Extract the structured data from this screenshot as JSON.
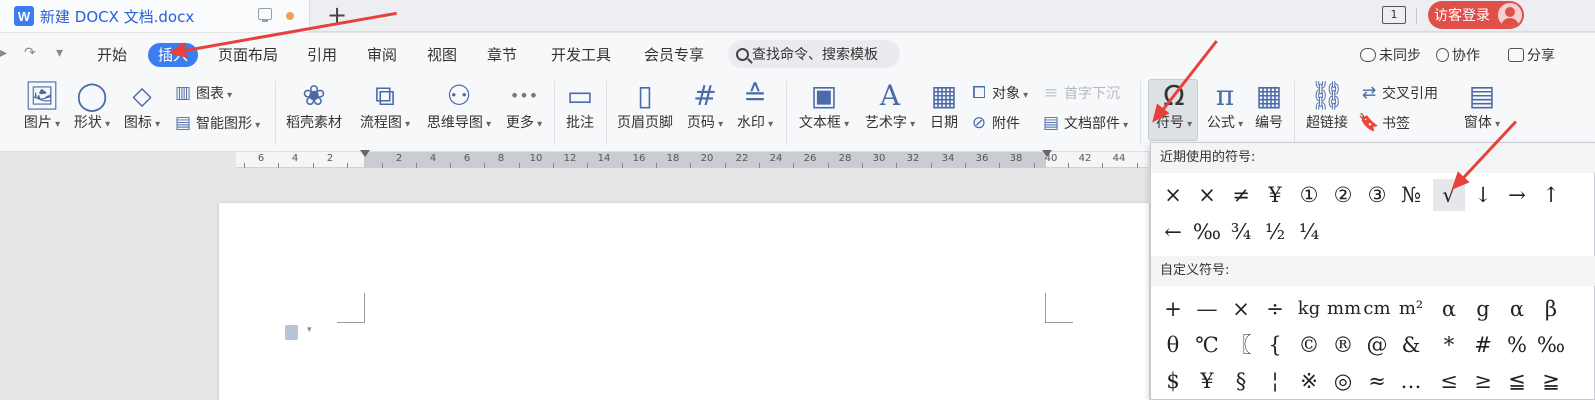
{
  "title_bar": {
    "doc_title": "新建 DOCX 文档.docx",
    "new_tab_glyph": "+",
    "window_badge": "1",
    "login_label": "访客登录"
  },
  "quick_access": {
    "undo": "↶",
    "redo": "↷",
    "more": "▾"
  },
  "menu": {
    "tabs": [
      "开始",
      "插入",
      "页面布局",
      "引用",
      "审阅",
      "视图",
      "章节",
      "开发工具",
      "会员专享"
    ],
    "active_tab": "插入",
    "search_placeholder": "查找命令、搜索模板",
    "right": {
      "sync": "未同步",
      "collab": "协作",
      "share": "分享"
    }
  },
  "ribbon": {
    "picture": "图片",
    "shape": "形状",
    "icon": "图标",
    "chart": "图表",
    "smart_graphic": "智能图形",
    "stock_material": "稻壳素材",
    "flowchart": "流程图",
    "mindmap": "思维导图",
    "more": "更多",
    "comment": "批注",
    "header_footer": "页眉页脚",
    "page_number": "页码",
    "watermark": "水印",
    "textbox": "文本框",
    "wordart": "艺术字",
    "date": "日期",
    "object": "对象",
    "attachment": "附件",
    "drop_cap": "首字下沉",
    "doc_parts": "文档部件",
    "symbol": "符号",
    "formula": "公式",
    "numbering": "编号",
    "hyperlink": "超链接",
    "cross_ref": "交叉引用",
    "bookmark": "书签",
    "window": "窗体"
  },
  "ruler": {
    "labels": [
      "6",
      "4",
      "2",
      "2",
      "4",
      "6",
      "8",
      "10",
      "12",
      "14",
      "16",
      "18",
      "20",
      "22",
      "24",
      "26",
      "28",
      "30",
      "32",
      "34",
      "36",
      "38",
      "40",
      "42",
      "44"
    ]
  },
  "symbol_panel": {
    "recent_title": "近期使用的符号:",
    "recent": [
      "×",
      "×",
      "≠",
      "¥",
      "①",
      "②",
      "③",
      "№",
      "√",
      "↓",
      "→",
      "↑",
      "←",
      "‰",
      "¾",
      "½",
      "¼"
    ],
    "highlighted": "√",
    "custom_title": "自定义符号:",
    "custom": [
      "+",
      "—",
      "×",
      "÷",
      "kg",
      "mm",
      "cm",
      "m²",
      "α",
      "g",
      "α",
      "β",
      "θ",
      "℃",
      "〖",
      "{",
      "©",
      "®",
      "@",
      "&",
      "*",
      "#",
      "%",
      "‰",
      "$",
      "¥",
      "§",
      "¦",
      "※",
      "◎",
      "≈",
      "…",
      "≤",
      "≥",
      "≦",
      "≧"
    ]
  },
  "icons": {
    "picture": "🖼",
    "shape": "◯",
    "icon": "⬦",
    "chart": "▥",
    "smart": "▤",
    "stock": "❀",
    "flow": "⧉",
    "mind": "⚇",
    "more": "•••",
    "comment": "▭",
    "header": "▯",
    "pagenum": "#",
    "watermark": "≙",
    "textbox": "▣",
    "wordart": "A",
    "date": "▦",
    "object": "⧠",
    "attach": "⊘",
    "dropcap": "≡",
    "docparts": "▤",
    "symbol": "Ω",
    "formula": "π",
    "numbering": "▦",
    "hyperlink": "⛓",
    "crossref": "⇄",
    "bookmark": "🔖",
    "window": "▤"
  }
}
